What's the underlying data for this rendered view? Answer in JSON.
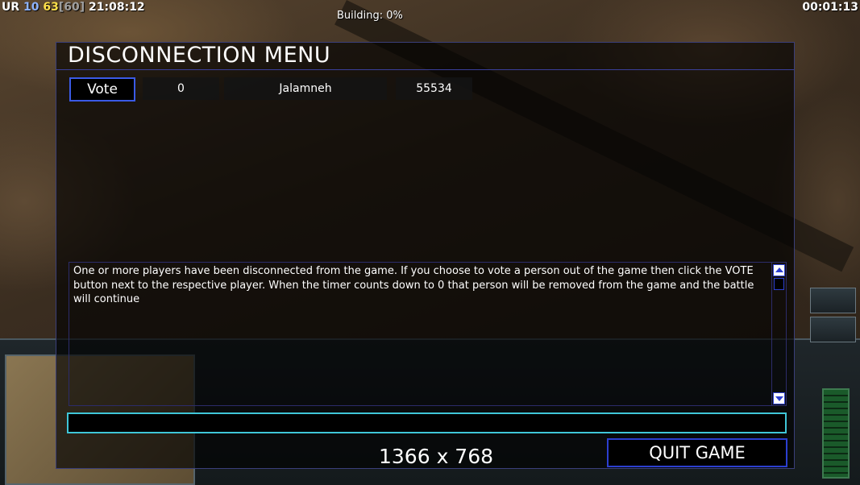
{
  "hud": {
    "left_prefix": "UR",
    "left_num1": "10",
    "left_num2": "63",
    "left_bracket": "[60]",
    "left_clock": "21:08:12",
    "right_timer": "00:01:13",
    "center_status": "Building: 0%"
  },
  "dialog": {
    "title": "DISCONNECTION MENU",
    "player_row": {
      "vote_label": "Vote",
      "number": "0",
      "name": "Jalamneh",
      "value": "55534"
    },
    "message": "One or more players have been disconnected from the game. If you choose to vote a person out of the game then click the VOTE button next to the respective player. When the timer counts down to 0 that person will be removed from the game and the battle will continue",
    "chat_value": "",
    "resolution": "1366 x 768",
    "quit_label": "QUIT GAME"
  },
  "colors": {
    "accent_blue": "#2c3fd0",
    "chat_border": "#3fc6d8",
    "hud_yellow": "#ffe04a"
  }
}
